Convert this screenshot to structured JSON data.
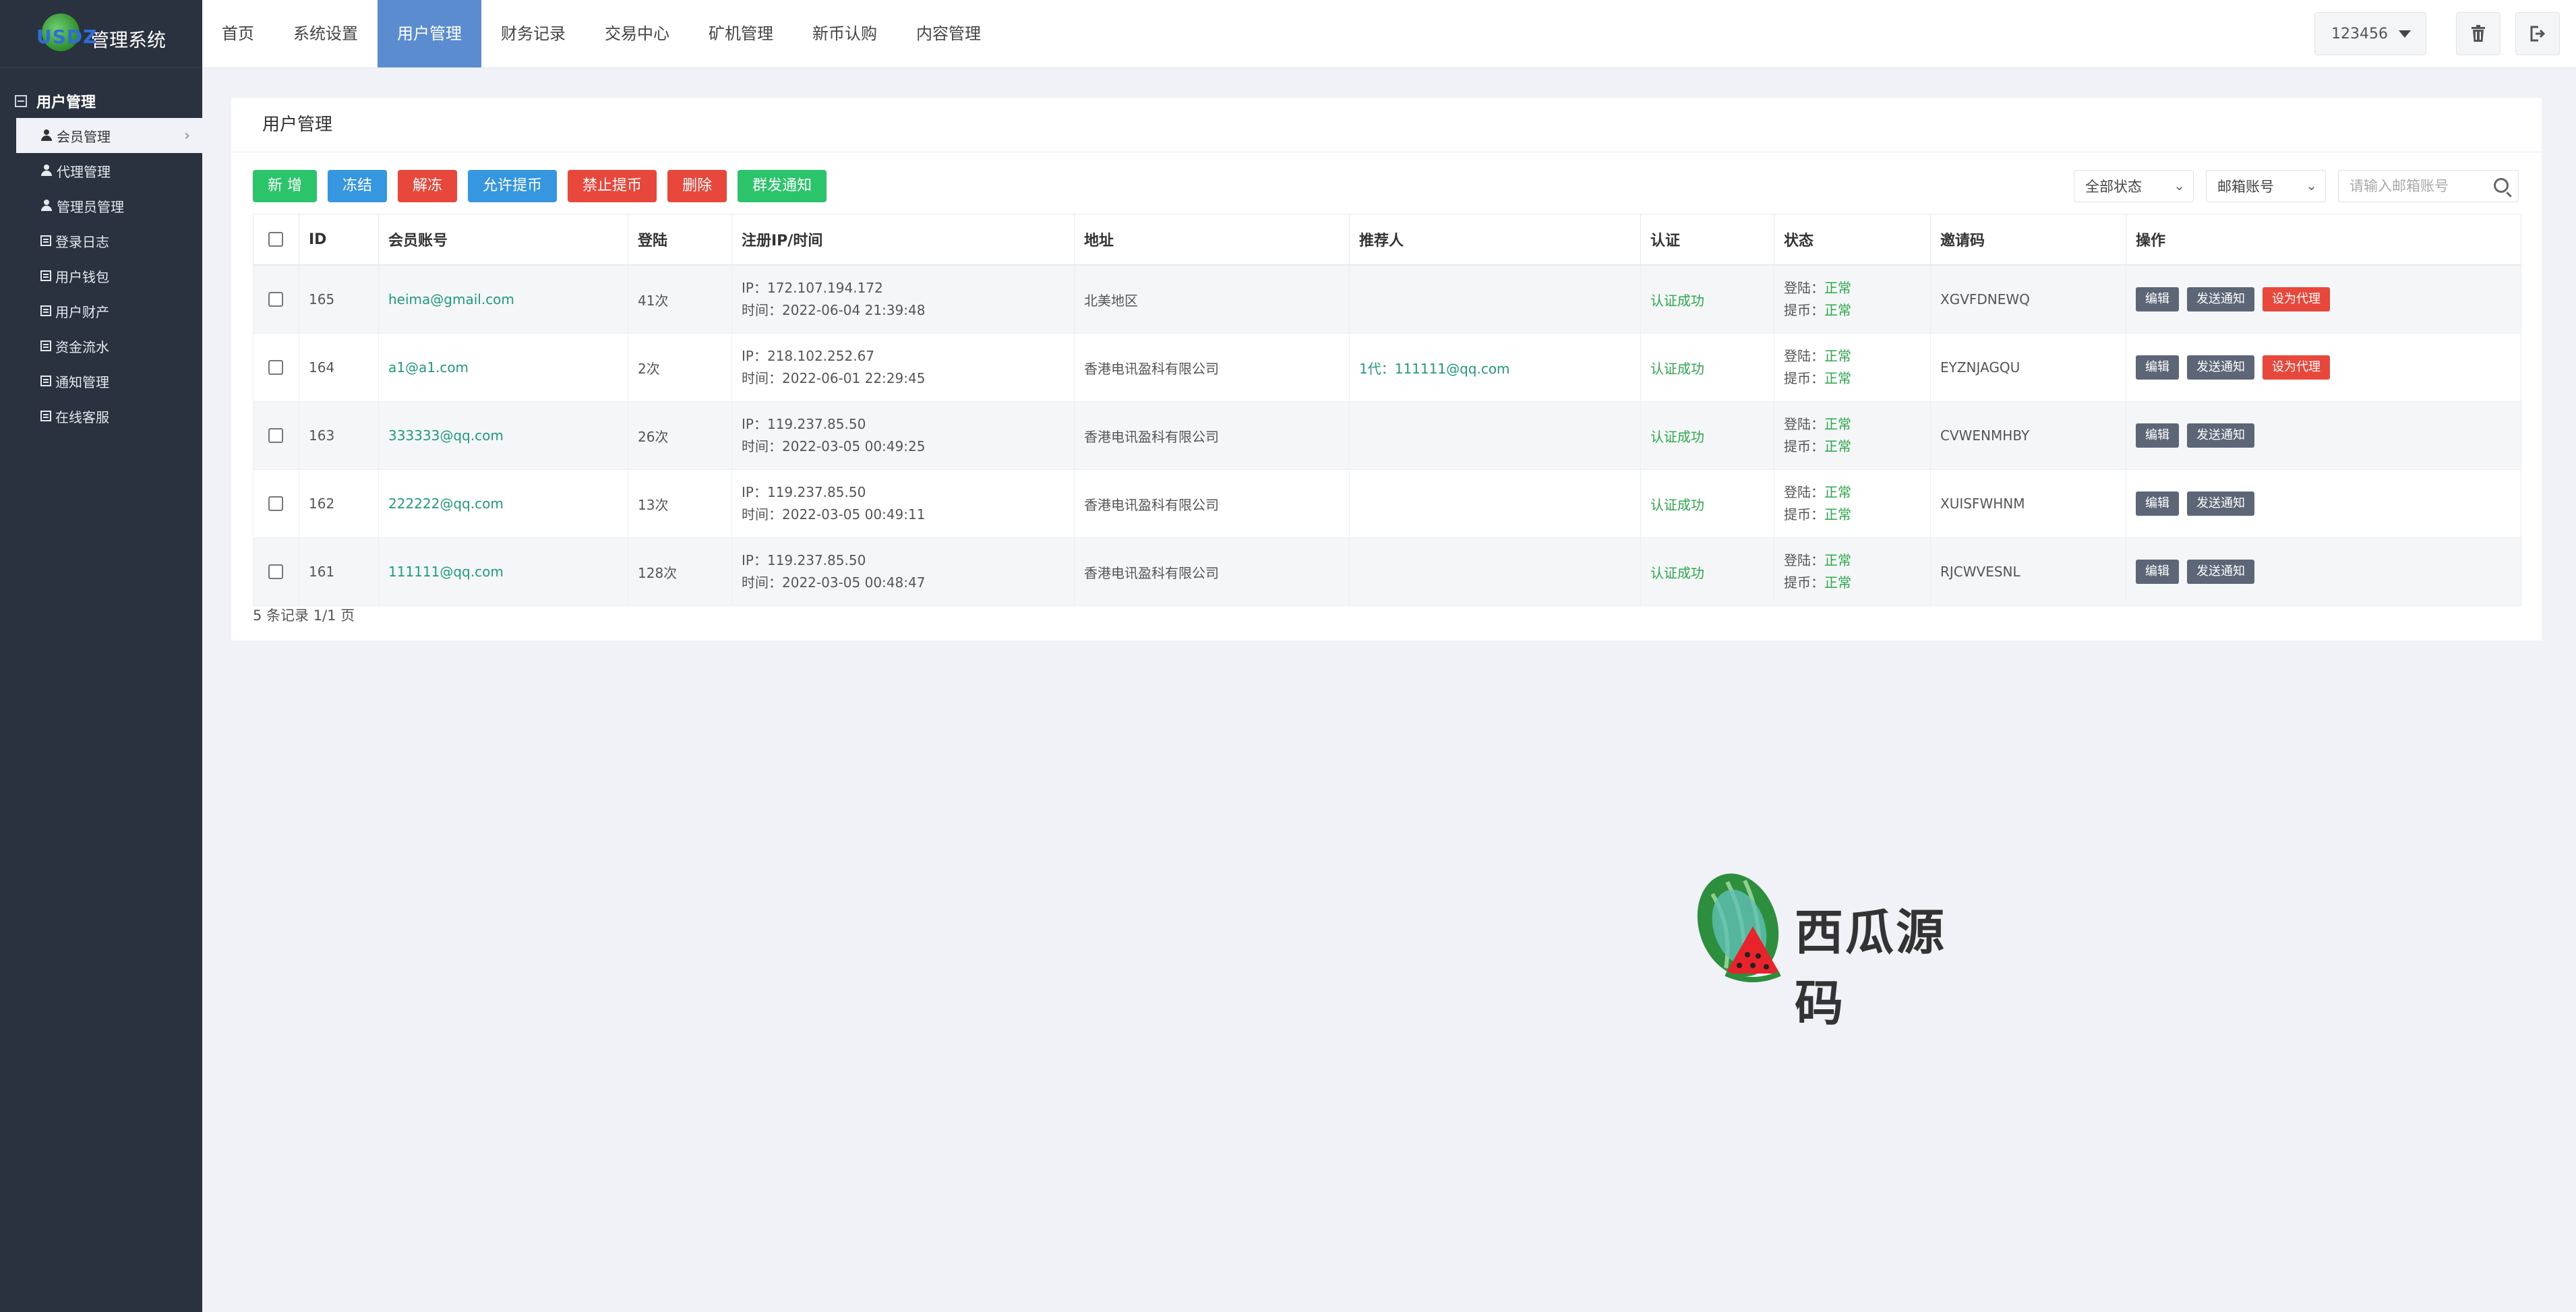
{
  "app": {
    "logo_text": "USDZ",
    "title": "管理系统"
  },
  "topnav": {
    "items": [
      "首页",
      "系统设置",
      "用户管理",
      "财务记录",
      "交易中心",
      "矿机管理",
      "新币认购",
      "内容管理"
    ],
    "active_index": 2,
    "user": "123456"
  },
  "sidebar": {
    "group": "用户管理",
    "items": [
      {
        "label": "会员管理",
        "icon": "user-icon"
      },
      {
        "label": "代理管理",
        "icon": "user-icon"
      },
      {
        "label": "管理员管理",
        "icon": "user-icon"
      },
      {
        "label": "登录日志",
        "icon": "list-icon"
      },
      {
        "label": "用户钱包",
        "icon": "list-icon"
      },
      {
        "label": "用户财产",
        "icon": "list-icon"
      },
      {
        "label": "资金流水",
        "icon": "list-icon"
      },
      {
        "label": "通知管理",
        "icon": "list-icon"
      },
      {
        "label": "在线客服",
        "icon": "list-icon"
      }
    ]
  },
  "panel": {
    "title": "用户管理"
  },
  "toolbar": {
    "add": "新 增",
    "freeze": "冻结",
    "unfreeze": "解冻",
    "allow": "允许提币",
    "forbid": "禁止提币",
    "delete": "删除",
    "notify": "群发通知"
  },
  "filters": {
    "status": "全部状态",
    "type": "邮箱账号",
    "search_placeholder": "请输入邮箱账号"
  },
  "table": {
    "headers": [
      "ID",
      "会员账号",
      "登陆",
      "注册IP/时间",
      "地址",
      "推荐人",
      "认证",
      "状态",
      "邀请码",
      "操作"
    ],
    "ip_prefix": "IP：",
    "time_prefix": "时间：",
    "login_status_label": "登陆：",
    "withdraw_status_label": "提币：",
    "rows": [
      {
        "id": "165",
        "account": "heima@gmail.com",
        "logins": "41次",
        "ip": "172.107.194.172",
        "time": "2022-06-04 21:39:48",
        "address": "北美地区",
        "referrer": "",
        "auth": "认证成功",
        "login_status": "正常",
        "withdraw_status": "正常",
        "code": "XGVFDNEWQ",
        "agent": true
      },
      {
        "id": "164",
        "account": "a1@a1.com",
        "logins": "2次",
        "ip": "218.102.252.67",
        "time": "2022-06-01 22:29:45",
        "address": "香港电讯盈科有限公司",
        "referrer": "1代：111111@qq.com",
        "auth": "认证成功",
        "login_status": "正常",
        "withdraw_status": "正常",
        "code": "EYZNJAGQU",
        "agent": true
      },
      {
        "id": "163",
        "account": "333333@qq.com",
        "logins": "26次",
        "ip": "119.237.85.50",
        "time": "2022-03-05 00:49:25",
        "address": "香港电讯盈科有限公司",
        "referrer": "",
        "auth": "认证成功",
        "login_status": "正常",
        "withdraw_status": "正常",
        "code": "CVWENMHBY",
        "agent": false
      },
      {
        "id": "162",
        "account": "222222@qq.com",
        "logins": "13次",
        "ip": "119.237.85.50",
        "time": "2022-03-05 00:49:11",
        "address": "香港电讯盈科有限公司",
        "referrer": "",
        "auth": "认证成功",
        "login_status": "正常",
        "withdraw_status": "正常",
        "code": "XUISFWHNM",
        "agent": false
      },
      {
        "id": "161",
        "account": "111111@qq.com",
        "logins": "128次",
        "ip": "119.237.85.50",
        "time": "2022-03-05 00:48:47",
        "address": "香港电讯盈科有限公司",
        "referrer": "",
        "auth": "认证成功",
        "login_status": "正常",
        "withdraw_status": "正常",
        "code": "RJCWVESNL",
        "agent": false
      }
    ],
    "op_labels": {
      "edit": "编辑",
      "notify": "发送通知",
      "agent": "设为代理"
    }
  },
  "pager": "5 条记录 1/1 页",
  "watermark": {
    "text": "西瓜源码"
  },
  "colors": {
    "sidebar": "#2b323f",
    "nav_active": "#5b8cd0",
    "green": "#2bc46a",
    "blue": "#3796e0",
    "red": "#e8483b",
    "link": "#1f9c7a"
  }
}
